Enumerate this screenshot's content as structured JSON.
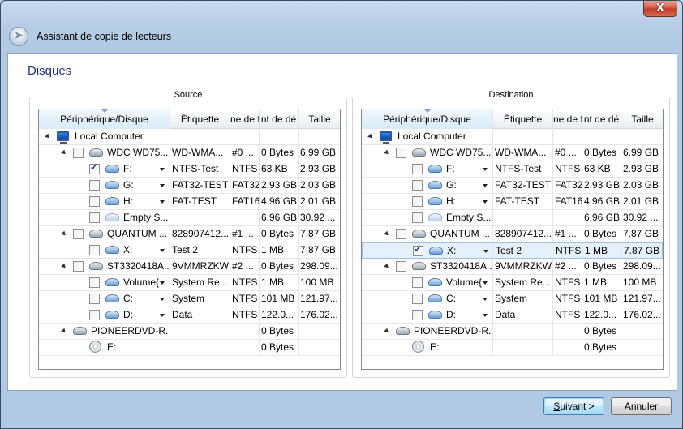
{
  "window": {
    "title": "Assistant de copie de lecteurs",
    "close_label": "X"
  },
  "page": {
    "heading": "Disques"
  },
  "columns": [
    "Périphérique/Disque",
    "Étiquette",
    "ne de f",
    "nt de dé",
    "Taille"
  ],
  "source": {
    "title": "Source",
    "rows": [
      {
        "level": 0,
        "expander": true,
        "checkbox": false,
        "icon": "computer-icon",
        "name": "Local Computer",
        "dropdown": false,
        "etiquette": "",
        "fs": "",
        "offset": "",
        "taille": ""
      },
      {
        "level": 1,
        "expander": true,
        "checkbox": true,
        "checked": false,
        "icon": "hard-disk-icon",
        "name": "WDC WD75...",
        "dropdown": false,
        "etiquette": "WD-WMA...",
        "fs": "#0 ...",
        "offset": "0 Bytes",
        "taille": "6.99 GB"
      },
      {
        "level": 2,
        "expander": false,
        "checkbox": true,
        "checked": true,
        "icon": "partition-icon",
        "name": "F:",
        "dropdown": true,
        "etiquette": "NTFS-Test",
        "fs": "NTFS",
        "offset": "63 KB",
        "taille": "2.93 GB"
      },
      {
        "level": 2,
        "expander": false,
        "checkbox": true,
        "checked": false,
        "icon": "partition-icon",
        "name": "G:",
        "dropdown": true,
        "etiquette": "FAT32-TEST",
        "fs": "FAT32",
        "offset": "2.93 GB",
        "taille": "2.03 GB"
      },
      {
        "level": 2,
        "expander": false,
        "checkbox": true,
        "checked": false,
        "icon": "partition-icon",
        "name": "H:",
        "dropdown": true,
        "etiquette": "FAT-TEST",
        "fs": "FAT16",
        "offset": "4.96 GB",
        "taille": "2.01 GB"
      },
      {
        "level": 2,
        "expander": false,
        "checkbox": true,
        "checked": false,
        "icon": "empty-space-icon",
        "name": "Empty S...",
        "dropdown": false,
        "etiquette": "",
        "fs": "",
        "offset": "6.96 GB",
        "taille": "30.92 ..."
      },
      {
        "level": 1,
        "expander": true,
        "checkbox": true,
        "checked": false,
        "icon": "hard-disk-icon",
        "name": "QUANTUM ...",
        "dropdown": false,
        "etiquette": "828907412...",
        "fs": "#1 ...",
        "offset": "0 Bytes",
        "taille": "7.87 GB"
      },
      {
        "level": 2,
        "expander": false,
        "checkbox": true,
        "checked": false,
        "icon": "partition-icon",
        "name": "X:",
        "dropdown": true,
        "etiquette": "Test 2",
        "fs": "NTFS",
        "offset": "1 MB",
        "taille": "7.87 GB"
      },
      {
        "level": 1,
        "expander": true,
        "checkbox": true,
        "checked": false,
        "icon": "hard-disk-icon",
        "name": "ST3320418A...",
        "dropdown": false,
        "etiquette": "9VMMRZKW",
        "fs": "#2 ...",
        "offset": "0 Bytes",
        "taille": "298.09..."
      },
      {
        "level": 2,
        "expander": false,
        "checkbox": true,
        "checked": false,
        "icon": "partition-icon",
        "name": "Volume{...",
        "dropdown": true,
        "etiquette": "System Re...",
        "fs": "NTFS",
        "offset": "1 MB",
        "taille": "100 MB"
      },
      {
        "level": 2,
        "expander": false,
        "checkbox": true,
        "checked": false,
        "icon": "partition-icon",
        "name": "C:",
        "dropdown": true,
        "etiquette": "System",
        "fs": "NTFS",
        "offset": "101 MB",
        "taille": "121.97..."
      },
      {
        "level": 2,
        "expander": false,
        "checkbox": true,
        "checked": false,
        "icon": "partition-icon",
        "name": "D:",
        "dropdown": true,
        "etiquette": "Data",
        "fs": "NTFS",
        "offset": "122.0...",
        "taille": "176.02..."
      },
      {
        "level": 1,
        "expander": true,
        "checkbox": false,
        "icon": "dvd-drive-icon",
        "name": "PIONEERDVD-R...",
        "dropdown": false,
        "etiquette": "",
        "fs": "",
        "offset": "0 Bytes",
        "taille": ""
      },
      {
        "level": 2,
        "expander": false,
        "checkbox": false,
        "icon": "cd-icon",
        "name": "E:",
        "dropdown": false,
        "etiquette": "",
        "fs": "",
        "offset": "0 Bytes",
        "taille": ""
      }
    ]
  },
  "destination": {
    "title": "Destination",
    "selected_row": 7,
    "rows": [
      {
        "level": 0,
        "expander": true,
        "checkbox": false,
        "icon": "computer-icon",
        "name": "Local Computer",
        "dropdown": false,
        "etiquette": "",
        "fs": "",
        "offset": "",
        "taille": ""
      },
      {
        "level": 1,
        "expander": true,
        "checkbox": true,
        "checked": false,
        "icon": "hard-disk-icon",
        "name": "WDC WD75...",
        "dropdown": false,
        "etiquette": "WD-WMA...",
        "fs": "#0 ...",
        "offset": "0 Bytes",
        "taille": "6.99 GB"
      },
      {
        "level": 2,
        "expander": false,
        "checkbox": true,
        "checked": false,
        "icon": "partition-icon",
        "name": "F:",
        "dropdown": true,
        "etiquette": "NTFS-Test",
        "fs": "NTFS",
        "offset": "63 KB",
        "taille": "2.93 GB"
      },
      {
        "level": 2,
        "expander": false,
        "checkbox": true,
        "checked": false,
        "icon": "partition-icon",
        "name": "G:",
        "dropdown": true,
        "etiquette": "FAT32-TEST",
        "fs": "FAT32",
        "offset": "2.93 GB",
        "taille": "2.03 GB"
      },
      {
        "level": 2,
        "expander": false,
        "checkbox": true,
        "checked": false,
        "icon": "partition-icon",
        "name": "H:",
        "dropdown": true,
        "etiquette": "FAT-TEST",
        "fs": "FAT16",
        "offset": "4.96 GB",
        "taille": "2.01 GB"
      },
      {
        "level": 2,
        "expander": false,
        "checkbox": true,
        "checked": false,
        "icon": "empty-space-icon",
        "name": "Empty S...",
        "dropdown": false,
        "etiquette": "",
        "fs": "",
        "offset": "6.96 GB",
        "taille": "30.92 ..."
      },
      {
        "level": 1,
        "expander": true,
        "checkbox": true,
        "checked": false,
        "icon": "hard-disk-icon",
        "name": "QUANTUM ...",
        "dropdown": false,
        "etiquette": "828907412...",
        "fs": "#1 ...",
        "offset": "0 Bytes",
        "taille": "7.87 GB"
      },
      {
        "level": 2,
        "expander": false,
        "checkbox": true,
        "checked": true,
        "icon": "partition-icon",
        "name": "X:",
        "dropdown": true,
        "etiquette": "Test 2",
        "fs": "NTFS",
        "offset": "1 MB",
        "taille": "7.87 GB"
      },
      {
        "level": 1,
        "expander": true,
        "checkbox": true,
        "checked": false,
        "icon": "hard-disk-icon",
        "name": "ST3320418A...",
        "dropdown": false,
        "etiquette": "9VMMRZKW",
        "fs": "#2 ...",
        "offset": "0 Bytes",
        "taille": "298.09..."
      },
      {
        "level": 2,
        "expander": false,
        "checkbox": true,
        "checked": false,
        "icon": "partition-icon",
        "name": "Volume{...",
        "dropdown": true,
        "etiquette": "System Re...",
        "fs": "NTFS",
        "offset": "1 MB",
        "taille": "100 MB"
      },
      {
        "level": 2,
        "expander": false,
        "checkbox": true,
        "checked": false,
        "icon": "partition-icon",
        "name": "C:",
        "dropdown": true,
        "etiquette": "System",
        "fs": "NTFS",
        "offset": "101 MB",
        "taille": "121.97..."
      },
      {
        "level": 2,
        "expander": false,
        "checkbox": true,
        "checked": false,
        "icon": "partition-icon",
        "name": "D:",
        "dropdown": true,
        "etiquette": "Data",
        "fs": "NTFS",
        "offset": "122.0...",
        "taille": "176.02..."
      },
      {
        "level": 1,
        "expander": true,
        "checkbox": false,
        "icon": "dvd-drive-icon",
        "name": "PIONEERDVD-R...",
        "dropdown": false,
        "etiquette": "",
        "fs": "",
        "offset": "0 Bytes",
        "taille": ""
      },
      {
        "level": 2,
        "expander": false,
        "checkbox": false,
        "icon": "cd-icon",
        "name": "E:",
        "dropdown": false,
        "etiquette": "",
        "fs": "",
        "offset": "0 Bytes",
        "taille": ""
      }
    ]
  },
  "buttons": {
    "next_prefix": "S",
    "next_rest": "uivant >",
    "cancel": "Annuler"
  }
}
